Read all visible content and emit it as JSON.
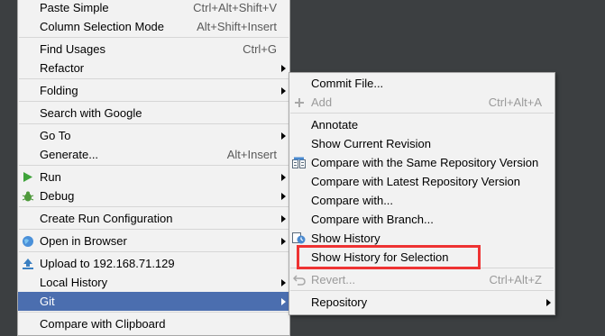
{
  "main_menu": {
    "paste_simple": {
      "label": "Paste Simple",
      "shortcut": "Ctrl+Alt+Shift+V"
    },
    "column_selection": {
      "label": "Column Selection Mode",
      "shortcut": "Alt+Shift+Insert"
    },
    "find_usages": {
      "label": "Find Usages",
      "shortcut": "Ctrl+G"
    },
    "refactor": {
      "label": "Refactor"
    },
    "folding": {
      "label": "Folding"
    },
    "search_google": {
      "label": "Search with Google"
    },
    "go_to": {
      "label": "Go To"
    },
    "generate": {
      "label": "Generate...",
      "shortcut": "Alt+Insert"
    },
    "run": {
      "label": "Run",
      "icon": "run-icon"
    },
    "debug": {
      "label": "Debug",
      "icon": "debug-icon"
    },
    "create_run_config": {
      "label": "Create Run Configuration"
    },
    "open_browser": {
      "label": "Open in Browser",
      "icon": "browser-icon"
    },
    "upload": {
      "label": "Upload to 192.168.71.129",
      "icon": "upload-icon"
    },
    "local_history": {
      "label": "Local History"
    },
    "git": {
      "label": "Git"
    },
    "compare_clipboard": {
      "label": "Compare with Clipboard"
    }
  },
  "git_submenu": {
    "commit_file": {
      "label": "Commit File..."
    },
    "add": {
      "label": "Add",
      "shortcut": "Ctrl+Alt+A",
      "icon": "plus-icon"
    },
    "annotate": {
      "label": "Annotate"
    },
    "show_current_revision": {
      "label": "Show Current Revision"
    },
    "compare_same_repo": {
      "label": "Compare with the Same Repository Version",
      "icon": "compare-icon"
    },
    "compare_latest_repo": {
      "label": "Compare with Latest Repository Version"
    },
    "compare_with": {
      "label": "Compare with..."
    },
    "compare_branch": {
      "label": "Compare with Branch..."
    },
    "show_history": {
      "label": "Show History",
      "icon": "history-icon"
    },
    "show_history_selection": {
      "label": "Show History for Selection"
    },
    "revert": {
      "label": "Revert...",
      "shortcut": "Ctrl+Alt+Z",
      "icon": "revert-icon"
    },
    "repository": {
      "label": "Repository"
    }
  },
  "colors": {
    "menu_background": "#f2f2f2",
    "selection": "#4b6eaf",
    "highlight_box": "#ee3333",
    "ide_background": "#3c3f41"
  }
}
